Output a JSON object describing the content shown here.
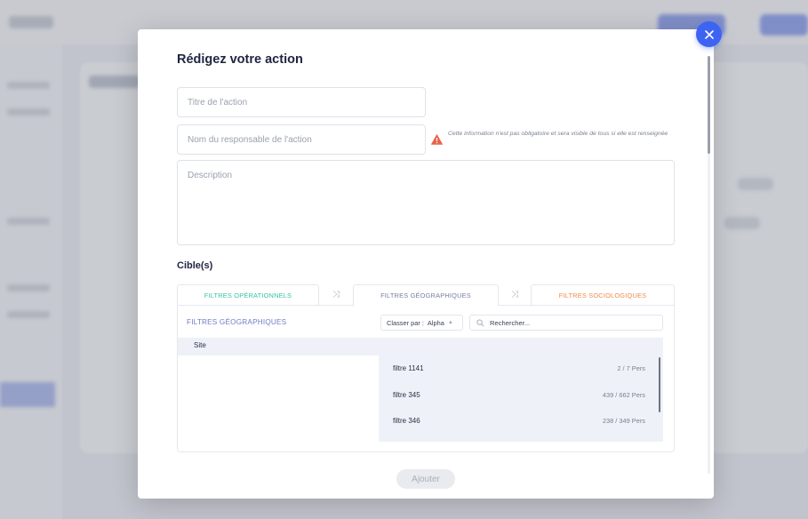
{
  "modal": {
    "title": "Rédigez votre action",
    "close_icon": "close-icon"
  },
  "form": {
    "title_placeholder": "Titre de l'action",
    "responsible_placeholder": "Nom du responsable de l'action",
    "description_placeholder": "Description",
    "warning_icon": "warning-icon",
    "warning_text": "Cette information n'est pas obligatoire et sera visible de tous si elle est renseignée"
  },
  "targets": {
    "label": "Cible(s)",
    "tabs": [
      {
        "label": "FILTRES OPÉRATIONNELS",
        "color": "#34c3a7"
      },
      {
        "label": "FILTRES GÉOGRAPHIQUES",
        "color": "#7a80a3",
        "active": true
      },
      {
        "label": "FILTRES SOCIOLOGIQUES",
        "color": "#f08a4b"
      }
    ],
    "panel_title": "FILTRES GÉOGRAPHIQUES",
    "sort_label": "Classer par :",
    "sort_value": "Alpha",
    "search_placeholder": "Rechercher...",
    "group_label": "Site",
    "items": [
      {
        "name": "filtre 1141",
        "count": "2 / 7 Pers"
      },
      {
        "name": "filtre 345",
        "count": "439 / 662 Pers"
      },
      {
        "name": "filtre 346",
        "count": "238 / 349 Pers"
      }
    ]
  },
  "footer": {
    "add_label": "Ajouter"
  },
  "colors": {
    "accent": "#3d63f2",
    "operational": "#34c3a7",
    "sociological": "#f08a4b",
    "warning": "#e8644a"
  }
}
